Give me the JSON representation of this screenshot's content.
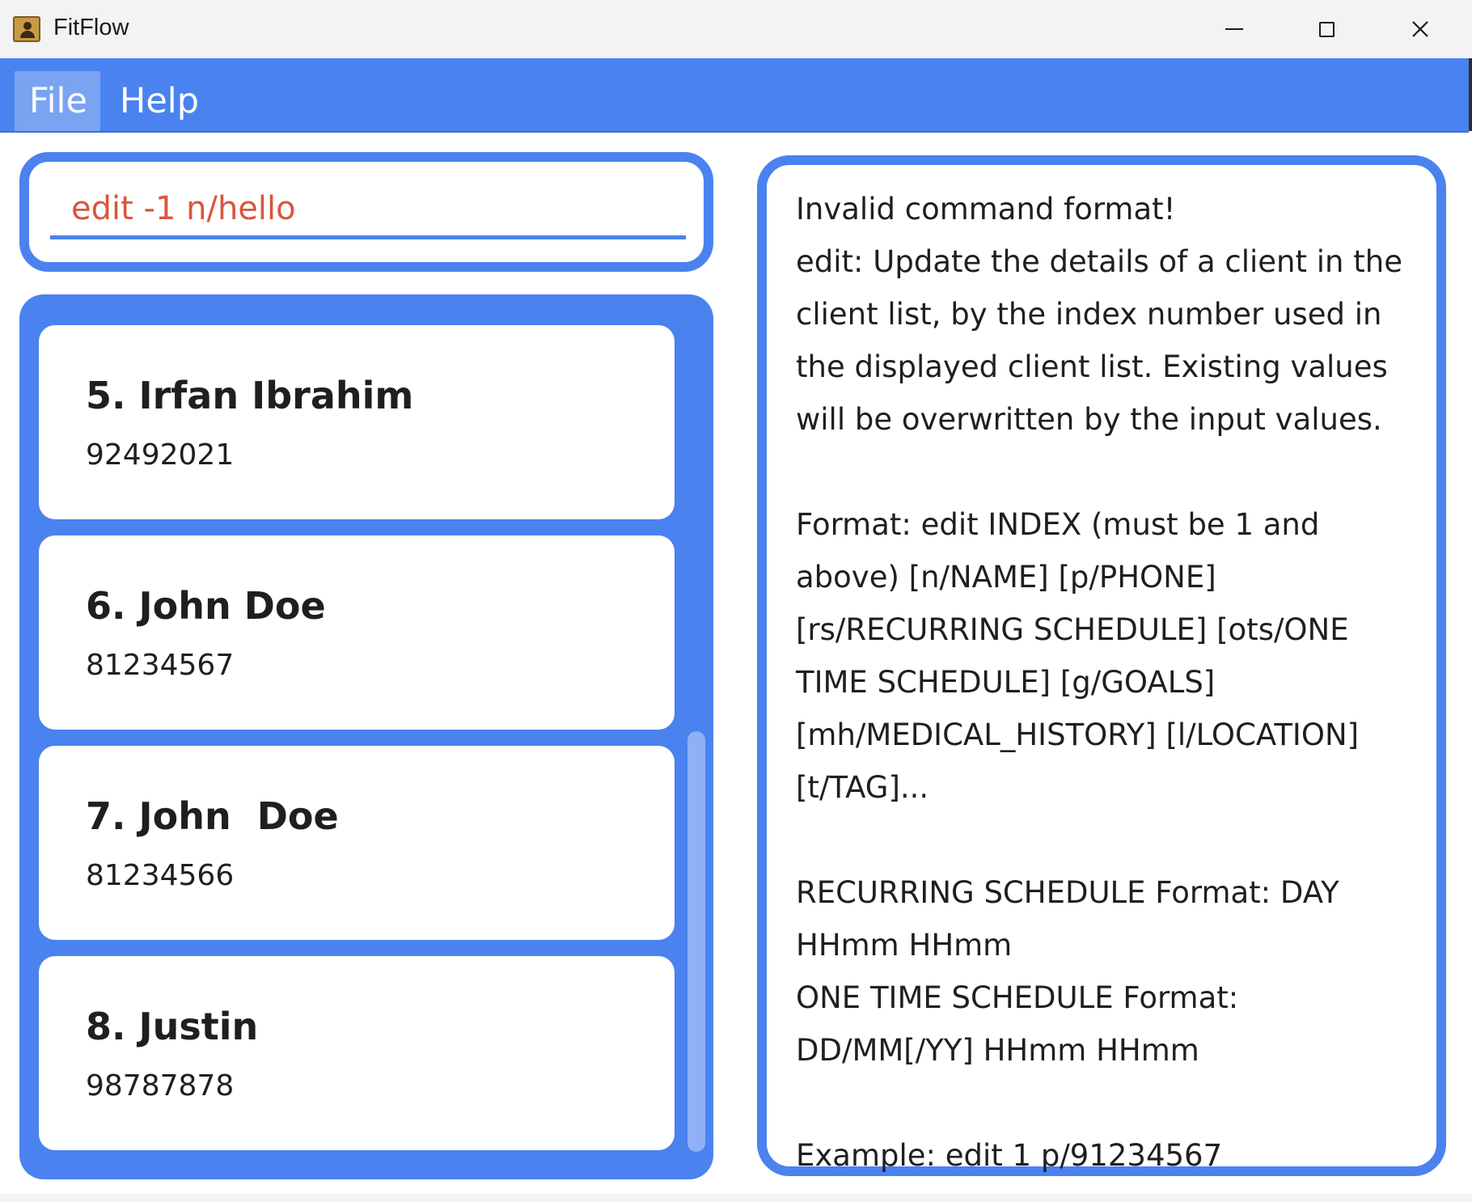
{
  "window": {
    "title": "FitFlow"
  },
  "menu": {
    "file": "File",
    "help": "Help"
  },
  "command": {
    "value": "edit -1 n/hello"
  },
  "clients": [
    {
      "name": "5. Irfan Ibrahim",
      "phone": "92492021"
    },
    {
      "name": "6. John Doe",
      "phone": "81234567"
    },
    {
      "name": "7. John  Doe",
      "phone": "81234566"
    },
    {
      "name": "8. Justin",
      "phone": "98787878"
    }
  ],
  "result": {
    "text": "Invalid command format!\nedit: Update the details of a client in the client list, by the index number used in the displayed client list. Existing values will be overwritten by the input values.\n\nFormat: edit INDEX (must be 1 and above) [n/NAME] [p/PHONE] [rs/RECURRING SCHEDULE] [ots/ONE TIME SCHEDULE] [g/GOALS][mh/MEDICAL_HISTORY] [l/LOCATION] [t/TAG]...\n\nRECURRING SCHEDULE Format: DAY HHmm HHmm\nONE TIME SCHEDULE Format: DD/MM[/YY] HHmm HHmm\n\nExample: edit 1 p/91234567"
  },
  "colors": {
    "accent": "#4a82ef",
    "menu_selected": "#7aa3f2",
    "error_text": "#d8563a"
  }
}
